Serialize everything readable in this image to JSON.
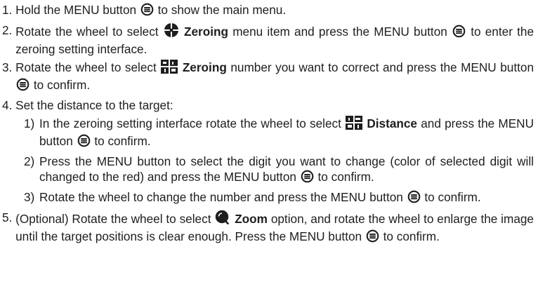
{
  "steps": [
    {
      "num": "1. ",
      "parts": [
        {
          "t": "Hold the MENU button "
        },
        {
          "icon": "menu-button-icon"
        },
        {
          "t": " to show the main menu."
        }
      ]
    },
    {
      "num": "2. ",
      "parts": [
        {
          "t": "Rotate the wheel to select "
        },
        {
          "icon": "zeroing-crosshair-icon"
        },
        {
          "t": " "
        },
        {
          "b": "Zeroing"
        },
        {
          "t": " menu item and press the MENU button "
        },
        {
          "icon": "menu-button-icon"
        },
        {
          "t": " to enter the zeroing setting interface."
        }
      ]
    },
    {
      "num": "3. ",
      "parts": [
        {
          "t": "Rotate the wheel to select "
        },
        {
          "icon": "zeroing-number-icon"
        },
        {
          "t": " "
        },
        {
          "b": "Zeroing"
        },
        {
          "t": " number you want to correct and press the MENU button "
        },
        {
          "icon": "menu-button-icon"
        },
        {
          "t": " to confirm."
        }
      ]
    },
    {
      "num": "4. ",
      "parts": [
        {
          "t": "Set the distance to the target:"
        }
      ],
      "subs": [
        {
          "num": "1)",
          "parts": [
            {
              "t": " In the zeroing setting interface rotate the wheel to select "
            },
            {
              "icon": "distance-icon"
            },
            {
              "t": " "
            },
            {
              "b": "Distance"
            },
            {
              "t": " and press the MENU button "
            },
            {
              "icon": "menu-button-icon"
            },
            {
              "t": " to confirm."
            }
          ]
        },
        {
          "num": "2)",
          "parts": [
            {
              "t": " Press the MENU button to select the digit you want to change (color of selected digit will changed to the red) and press the MENU button "
            },
            {
              "icon": "menu-button-icon"
            },
            {
              "t": " to confirm."
            }
          ]
        },
        {
          "num": "3)",
          "parts": [
            {
              "t": " Rotate the wheel to change the number and press the MENU button "
            },
            {
              "icon": "menu-button-icon"
            },
            {
              "t": " to confirm."
            }
          ]
        }
      ]
    },
    {
      "num": "5. ",
      "parts": [
        {
          "t": "(Optional) Rotate the wheel to select "
        },
        {
          "icon": "zoom-icon"
        },
        {
          "t": " "
        },
        {
          "b": "Zoom"
        },
        {
          "t": " option, and rotate the wheel to enlarge the image until the target positions is clear enough. Press the MENU button "
        },
        {
          "icon": "menu-button-icon"
        },
        {
          "t": " to confirm."
        }
      ]
    }
  ],
  "colors": {
    "text": "#1e1e1e",
    "icon": "#1e1e1e"
  }
}
